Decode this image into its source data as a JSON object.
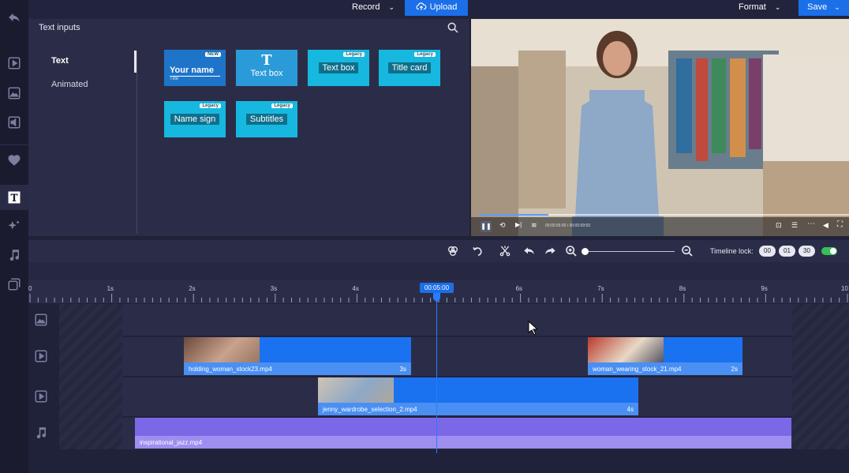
{
  "topbar": {
    "record_label": "Record",
    "upload_label": "Upload",
    "format_label": "Format",
    "save_label": "Save"
  },
  "panel": {
    "title": "Text inputs",
    "categories": [
      "Text",
      "Animated"
    ],
    "tiles": [
      {
        "label": "Your name",
        "sub": "Title",
        "badge": "NEW"
      },
      {
        "label": "Text box",
        "badge": ""
      },
      {
        "label": "Text box",
        "badge": "Legacy"
      },
      {
        "label": "Title card",
        "badge": "Legacy"
      },
      {
        "label": "Name sign",
        "badge": "Legacy"
      },
      {
        "label": "Subtitles",
        "badge": "Legacy"
      }
    ]
  },
  "player": {
    "timecode": "00:00:05:00 / 00:00:09:50",
    "progress": 0.19
  },
  "timeline": {
    "lock_label": "Timeline lock:",
    "lock_values": [
      "00",
      "01",
      "30"
    ],
    "lock_enabled": true,
    "zoom_level": 0.0,
    "playhead_time": "00:05:00",
    "ruler": [
      "0",
      "1s",
      "2s",
      "3s",
      "4s",
      "5s",
      "6s",
      "7s",
      "8s",
      "9s",
      "10"
    ],
    "clips": [
      {
        "name": "holding_woman_stock23.mp4",
        "duration": "3s"
      },
      {
        "name": "woman_wearing_stock_21.mp4",
        "duration": "2s"
      },
      {
        "name": "jenny_wardrobe_selection_2.mp4",
        "duration": "4s"
      },
      {
        "name": "inspirational_jazz.mp4",
        "duration": ""
      }
    ]
  },
  "colors": {
    "accent": "#1b6fe8",
    "clip_video": "#1b72f0",
    "clip_audio": "#7b68e6",
    "tile": "#17b8e0"
  }
}
